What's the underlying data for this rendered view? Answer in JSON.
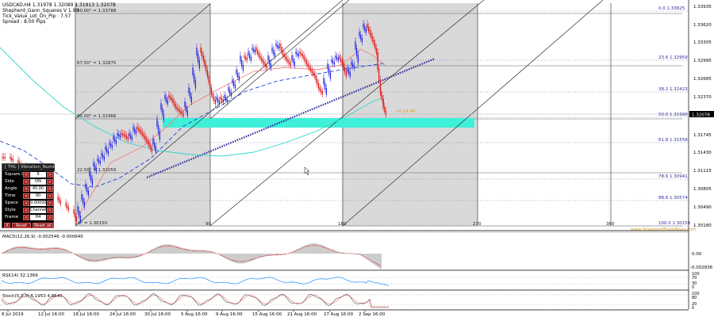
{
  "header": {
    "symbol_line": "USDCAD,H4   1.31978 1.32089 1.31913 1.32078",
    "indicator_name": "Shepherd_Gann_Squares V 1.90",
    "tick_value": "Tick_Value_Lot_On_Pip : 7.57",
    "spread": "Spread : 8.00  Pips"
  },
  "price_axis": {
    "labels": [
      "1.33935",
      "1.33620",
      "1.33305",
      "1.32995",
      "1.32685",
      "1.32370",
      "1.32078",
      "1.31745",
      "1.31430",
      "1.31115",
      "1.30805",
      "1.30490",
      "1.30180"
    ],
    "current_price": "1.32078"
  },
  "gann_angles": [
    {
      "label": "90.00° = 1.33788"
    },
    {
      "label": "67.50° = 1.32875"
    },
    {
      "label": "45.00° = 1.31966"
    },
    {
      "label": "22.50° = 1.31059"
    },
    {
      "label": "0° = 1.30150"
    }
  ],
  "fib_levels": [
    {
      "pct": "0.0",
      "price": "1.33825"
    },
    {
      "pct": "23.6",
      "price": "1.32959"
    },
    {
      "pct": "38.2",
      "price": "1.32423"
    },
    {
      "pct": "50.0",
      "price": "1.31990"
    },
    {
      "pct": "61.8",
      "price": "1.31558"
    },
    {
      "pct": "78.6",
      "price": "1.30941"
    },
    {
      "pct": "88.6",
      "price": "1.30574"
    },
    {
      "pct": "100.0",
      "price": "1.30156"
    }
  ],
  "time_markers": [
    "90",
    "180",
    "270",
    "360"
  ],
  "pips_annotation": "+0.24.48",
  "watermark": "www.ShepherdTradeBoss.com",
  "controls": {
    "title": "[ THL ] Vibration_Number : 7",
    "rows": [
      {
        "label": "Square Of",
        "value": "9"
      },
      {
        "label": "Side",
        "value": "ON"
      },
      {
        "label": "Angle",
        "value": "45.00"
      },
      {
        "label": "Time",
        "value": "90"
      },
      {
        "label": "Space",
        "value": "0.00000"
      },
      {
        "label": "Style",
        "value": "Channel"
      },
      {
        "label": "Frame",
        "value": "H4"
      }
    ],
    "reset_label": "Reset",
    "reset_all_label": "Reset all",
    "x_label": "X"
  },
  "macd": {
    "label": "MACD(12,26,9) -0.002546 -0.000640",
    "axis": [
      "0.00",
      "-0.002836"
    ]
  },
  "rsi": {
    "label": "RSI(14) 32.1369",
    "axis": [
      "100",
      "70",
      "30",
      "0"
    ]
  },
  "stoch": {
    "label": "Stoch(5,3,3) 6.1953 4.8545",
    "axis": [
      "100",
      "80",
      "20",
      "0"
    ]
  },
  "date_axis": [
    "8 Jul 2019",
    "12 Jul 16:00",
    "18 Jul 16:00",
    "24 Jul 16:00",
    "30 Jul 16:00",
    "5 Aug 16:00",
    "9 Aug 16:00",
    "15 Aug 16:00",
    "21 Aug 16:00",
    "27 Aug 16:00",
    "2 Sep 16:00"
  ],
  "colors": {
    "bull": "#1a1ae6",
    "bear": "#e01010",
    "cyan_zone": "#3ef0d8",
    "gray_box": "#d3d3d3",
    "ma_red": "#f08080",
    "ma_blue": "#1f3fd0",
    "ma_cyan": "#30d8c8"
  }
}
